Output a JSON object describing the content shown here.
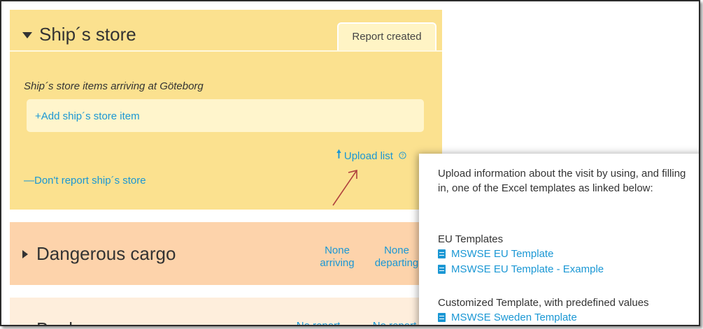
{
  "ships_store": {
    "title": "Ship´s store",
    "tab_label": "Report created",
    "subtitle": "Ship´s store items arriving at Göteborg",
    "add_item_label": "+Add ship´s store item",
    "upload_label": "Upload list",
    "help_icon": "?",
    "dont_report_label": "—Don't report ship´s store"
  },
  "dangerous_cargo": {
    "title": "Dangerous cargo",
    "arriving_line1": "None",
    "arriving_line2": "arriving",
    "departing_line1": "None",
    "departing_line2": "departing"
  },
  "bunker": {
    "title": "Bunker",
    "status1": "No report",
    "status2": "No report"
  },
  "tooltip": {
    "intro": "Upload information about the visit by using, and filling in, one of the Excel templates as linked below:",
    "eu_heading": "EU Templates",
    "eu_links": [
      "MSWSE EU Template",
      "MSWSE EU Template - Example"
    ],
    "custom_heading": "Customized Template, with predefined values",
    "custom_links": [
      "MSWSE Sweden Template"
    ]
  },
  "colors": {
    "store_bg": "#fbe18f",
    "danger_bg": "#fdd3ab",
    "bunker_bg": "#feeedc",
    "link": "#1a97d4",
    "annotation_arrow": "#b0413e"
  },
  "icons": {
    "collapse": "caret-down-icon",
    "expand": "caret-right-icon",
    "upload": "upload-arrow-icon",
    "help": "help-circle-icon",
    "document": "document-icon"
  }
}
